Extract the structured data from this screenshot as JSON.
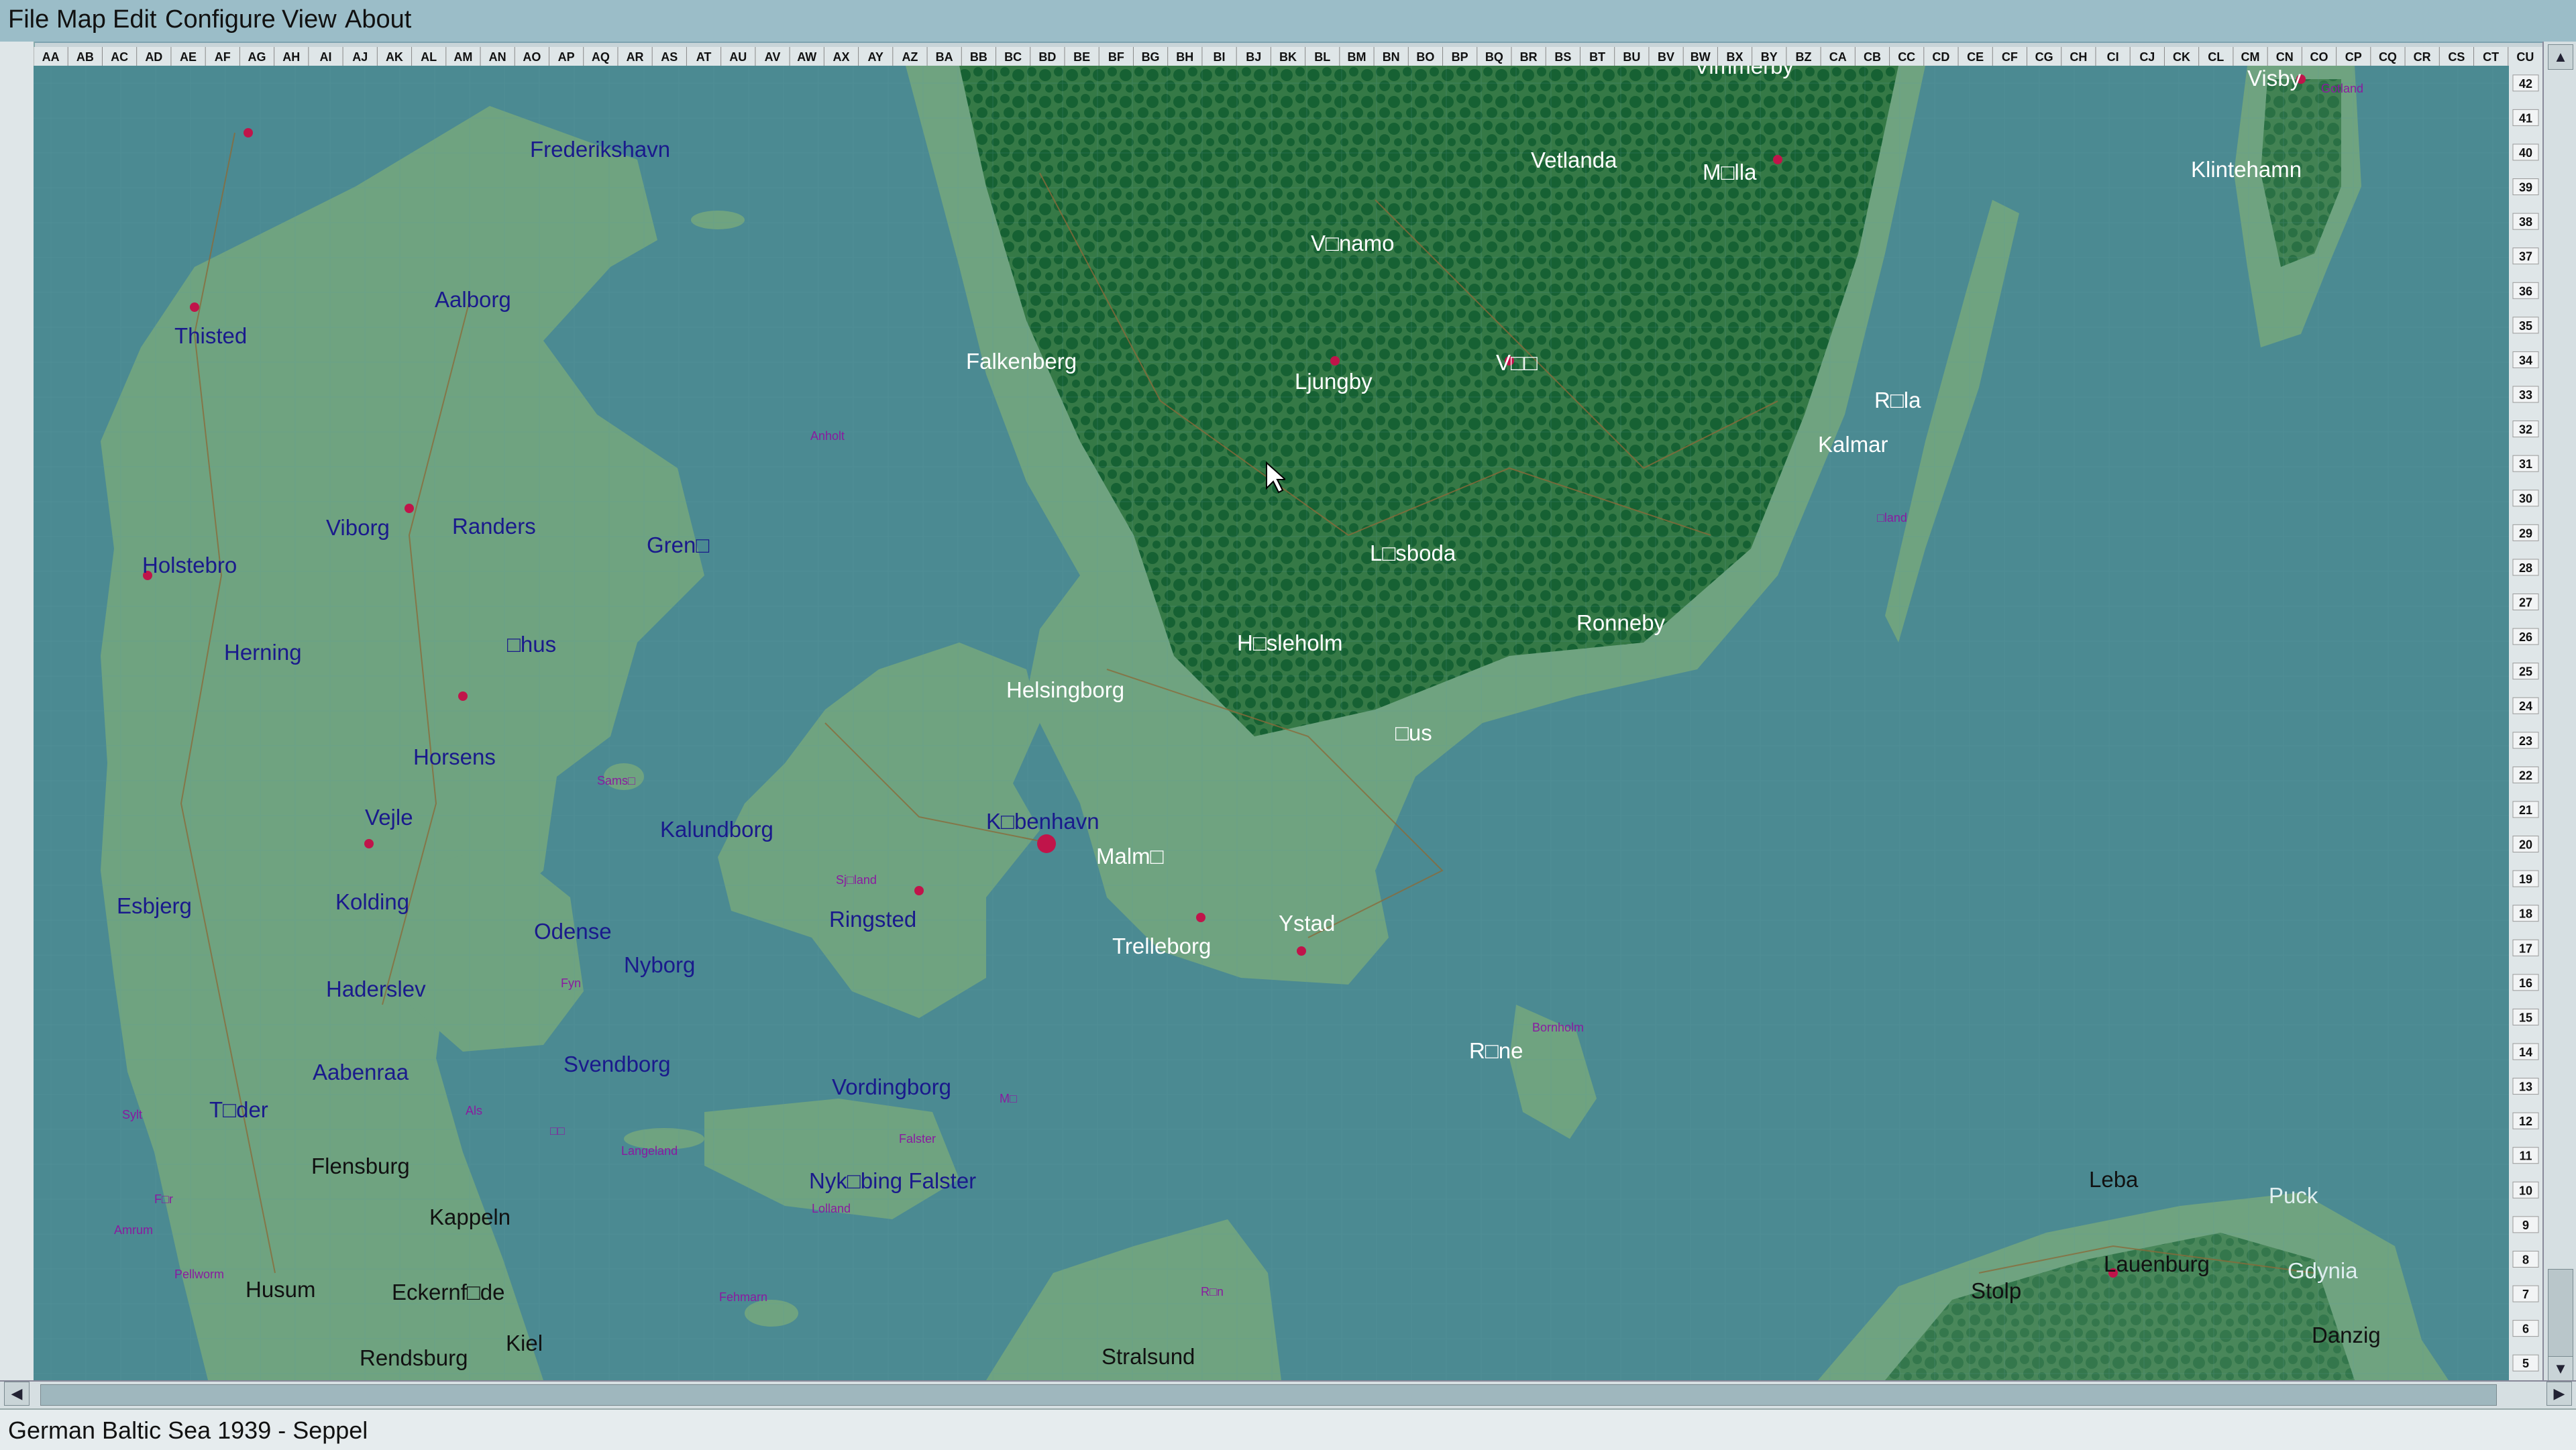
{
  "menu": {
    "file": "File",
    "map": "Map",
    "edit": "Edit",
    "configure": "Configure",
    "view": "View",
    "about": "About"
  },
  "status": "German Baltic Sea 1939 - Seppel",
  "columns": [
    "AA",
    "AB",
    "AC",
    "AD",
    "AE",
    "AF",
    "AG",
    "AH",
    "AI",
    "AJ",
    "AK",
    "AL",
    "AM",
    "AN",
    "AO",
    "AP",
    "AQ",
    "AR",
    "AS",
    "AT",
    "AU",
    "AV",
    "AW",
    "AX",
    "AY",
    "AZ",
    "BA",
    "BB",
    "BC",
    "BD",
    "BE",
    "BF",
    "BG",
    "BH",
    "BI",
    "BJ",
    "BK",
    "BL",
    "BM",
    "BN",
    "BO",
    "BP",
    "BQ",
    "BR",
    "BS",
    "BT",
    "BU",
    "BV",
    "BW",
    "BX",
    "BY",
    "BZ",
    "CA",
    "CB",
    "CC",
    "CD",
    "CE",
    "CF",
    "CG",
    "CH",
    "CI",
    "CJ",
    "CK",
    "CL",
    "CM",
    "CN",
    "CO",
    "CP",
    "CQ",
    "CR",
    "CS",
    "CT",
    "CU"
  ],
  "rows": [
    "42",
    "41",
    "40",
    "39",
    "38",
    "37",
    "36",
    "35",
    "34",
    "33",
    "32",
    "31",
    "30",
    "29",
    "28",
    "27",
    "26",
    "25",
    "24",
    "23",
    "22",
    "21",
    "20",
    "19",
    "18",
    "17",
    "16",
    "15",
    "14",
    "13",
    "12",
    "11",
    "10",
    "9",
    "8",
    "7",
    "6",
    "5"
  ],
  "cities_dk": {
    "frederikshavn": "Frederikshavn",
    "aalborg": "Aalborg",
    "thisted": "Thisted",
    "viborg": "Viborg",
    "randers": "Randers",
    "grena": "Gren□",
    "holstebro": "Holstebro",
    "herning": "Herning",
    "arhus": "□hus",
    "horsens": "Horsens",
    "vejle": "Vejle",
    "kalundborg": "Kalundborg",
    "kobenhavn": "K□benhavn",
    "esbjerg": "Esbjerg",
    "kolding": "Kolding",
    "odense": "Odense",
    "nyborg": "Nyborg",
    "ringsted": "Ringsted",
    "haderslev": "Haderslev",
    "svendborg": "Svendborg",
    "aabenraa": "Aabenraa",
    "vordingborg": "Vordingborg",
    "tonder": "T□der",
    "nykobing": "Nyk□bing Falster"
  },
  "cities_se": {
    "vimmerby": "Vimmerby",
    "vetlanda": "Vetlanda",
    "monsteras": "M□lla",
    "varnamo": "V□namo",
    "falkenberg": "Falkenberg",
    "ljungby": "Ljungby",
    "vaxjo": "V□□",
    "borgholm": "R□la",
    "kalmar": "Kalmar",
    "hassleholm_l": "L□sboda",
    "ronneby": "Ronneby",
    "hassleholm": "H□sleholm",
    "helsingborg": "Helsingborg",
    "ahus": "□us",
    "malmo": "Malm□",
    "trelleborg": "Trelleborg",
    "ystad": "Ystad",
    "ronne": "R□ne",
    "visby": "Visby",
    "klintehamn": "Klintehamn"
  },
  "cities_de": {
    "flensburg": "Flensburg",
    "kappeln": "Kappeln",
    "husum": "Husum",
    "eckernforde": "Eckernf□de",
    "rendsburg": "Rendsburg",
    "kiel": "Kiel",
    "stralsund": "Stralsund",
    "stolp": "Stolp",
    "danzig": "Danzig",
    "lauenburg": "Lauenburg",
    "leba": "Leba"
  },
  "cities_pl": {
    "puck": "Puck",
    "gdynia": "Gdynia"
  },
  "islands": {
    "anholt": "Anholt",
    "samso": "Sams□",
    "sjaelland": "Sj□land",
    "fyn": "Fyn",
    "als": "Als",
    "aero": "□□",
    "langeland": "Langeland",
    "mon": "M□",
    "falster": "Falster",
    "lolland": "Lolland",
    "sylt": "Sylt",
    "fohr": "F□r",
    "amrum": "Amrum",
    "pellworm": "Pellworm",
    "fehmarn": "Fehmarn",
    "rugen": "R□n",
    "bornholm": "Bornholm",
    "oland": "□land",
    "gotland": "Gotland"
  },
  "colors": {
    "sea": "#4b8a92",
    "land": "#6fa380",
    "forest": "#0c5a2a",
    "road": "#8a6a3a",
    "town": "#c0144a",
    "menubar": "#9bbdc8"
  }
}
